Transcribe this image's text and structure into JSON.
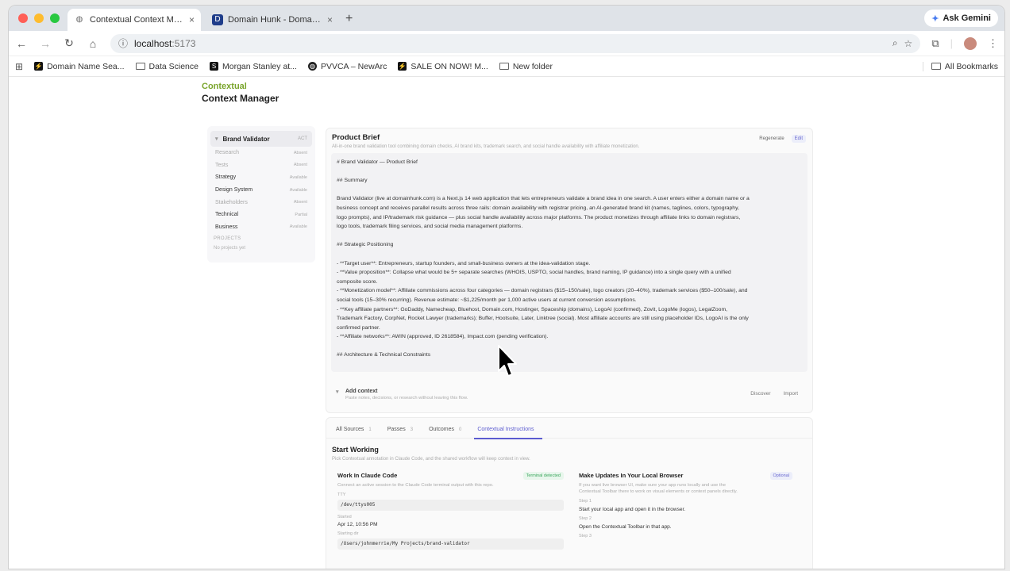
{
  "browser": {
    "tabs": [
      {
        "title": "Contextual Context Manager",
        "active": true,
        "icon": "globe-icon"
      },
      {
        "title": "Domain Hunk - Domain Validator",
        "active": false,
        "icon": "domain-hunk-favicon"
      }
    ],
    "new_tab": "+",
    "ask_gemini": "Ask Gemini",
    "url_host": "localhost",
    "url_port": ":5173",
    "bookmarks": [
      {
        "label": "Domain Name Sea...",
        "icon": "bolt-icon"
      },
      {
        "label": "Data Science",
        "icon": "folder-icon"
      },
      {
        "label": "Morgan Stanley at...",
        "icon": "s-logo-icon"
      },
      {
        "label": "PVVCA – NewArc",
        "icon": "globe-icon"
      },
      {
        "label": "SALE ON NOW! M...",
        "icon": "bolt-icon"
      },
      {
        "label": "New folder",
        "icon": "folder-icon"
      }
    ],
    "all_bookmarks": "All Bookmarks"
  },
  "app": {
    "logo_top": "Contextual",
    "logo_bottom": "Context Manager"
  },
  "sidebar": {
    "head": {
      "label": "Brand Validator",
      "meta": "ACT"
    },
    "items": [
      {
        "label": "Research",
        "meta": "Absent",
        "muted": true
      },
      {
        "label": "Tests",
        "meta": "Absent",
        "muted": true
      },
      {
        "label": "Strategy",
        "meta": "Available",
        "muted": false
      },
      {
        "label": "Design System",
        "meta": "Available",
        "muted": false
      },
      {
        "label": "Stakeholders",
        "meta": "Absent",
        "muted": true
      },
      {
        "label": "Technical",
        "meta": "Partial",
        "muted": false
      },
      {
        "label": "Business",
        "meta": "Available",
        "muted": false
      }
    ],
    "section": "PROJECTS",
    "note": "No projects yet"
  },
  "brief": {
    "title": "Product Brief",
    "subtitle": "All-in-one brand validation tool combining domain checks, AI brand kits, trademark search, and social handle availability with affiliate monetization.",
    "regenerate": "Regenerate",
    "edit": "Edit",
    "lines": [
      "# Brand Validator — Product Brief",
      "",
      "## Summary",
      "",
      "Brand Validator (live at domainhunk.com) is a Next.js 14 web application that lets entrepreneurs validate a brand idea in one search. A user enters either a domain name or a",
      "business concept and receives parallel results across three rails: domain availability with registrar pricing, an AI-generated brand kit (names, taglines, colors, typography,",
      "logo prompts), and IP/trademark risk guidance — plus social handle availability across major platforms. The product monetizes through affiliate links to domain registrars,",
      "logo tools, trademark filing services, and social media management platforms.",
      "",
      "## Strategic Positioning",
      "",
      "- **Target user**: Entrepreneurs, startup founders, and small-business owners at the idea-validation stage.",
      "- **Value proposition**: Collapse what would be 5+ separate searches (WHOIS, USPTO, social handles, brand naming, IP guidance) into a single query with a unified",
      "composite score.",
      "- **Monetization model**: Affiliate commissions across four categories — domain registrars ($15–150/sale), logo creators (20–40%), trademark services ($50–100/sale), and",
      "social tools (15–30% recurring). Revenue estimate: ~$1,225/month per 1,000 active users at current conversion assumptions.",
      "- **Key affiliate partners**: GoDaddy, Namecheap, Bluehost, Domain.com, Hostinger, Spaceship (domains), LogoAI (confirmed), Zovit, LogoMe (logos), LegalZoom,",
      "Trademark Factory, CorpNet, Rocket Lawyer (trademarks); Buffer, Hootsuite, Later, Linktree (social). Most affiliate accounts are still using placeholder IDs, LogoAI is the only",
      "confirmed partner.",
      "- **Affiliate networks**: AWIN (approved, ID 2618584), Impact.com (pending verification).",
      "",
      "## Architecture & Technical Constraints"
    ],
    "add_context": "Add context",
    "add_context_sub": "Paste notes, decisions, or research without leaving this flow.",
    "discover": "Discover",
    "import": "Import"
  },
  "panel": {
    "tabs": [
      {
        "label": "All Sources",
        "count": "1",
        "active": false
      },
      {
        "label": "Passes",
        "count": "3",
        "active": false
      },
      {
        "label": "Outcomes",
        "count": "0",
        "active": false
      },
      {
        "label": "Contextual Instructions",
        "count": "",
        "active": true
      }
    ],
    "start_title": "Start Working",
    "start_sub": "Pick Contextual annotation in Claude Code, and the shared workflow will keep context in view.",
    "left": {
      "title": "Work In Claude Code",
      "pill": "Terminal detected",
      "sub": "Connect an active session to the Claude Code terminal output with this repo.",
      "tty_label": "TTY",
      "tty_value": "/dev/ttys005",
      "started_label": "Started",
      "started_value": "Apr 12, 10:56 PM",
      "dir_label": "Starting dir",
      "dir_value": "/Users/johnmerrie/My Projects/brand-validator"
    },
    "right": {
      "title": "Make Updates In Your Local Browser",
      "pill": "Optional",
      "sub": "If you want live browser UI, make sure your app runs locally and use the Contextual Toolbar there to work on visual elements or context panels directly.",
      "step1_label": "Step 1",
      "step1_text": "Start your local app and open it in the browser.",
      "step2_label": "Step 2",
      "step2_text": "Open the Contextual Toolbar in that app.",
      "step3_label": "Step 3"
    }
  }
}
